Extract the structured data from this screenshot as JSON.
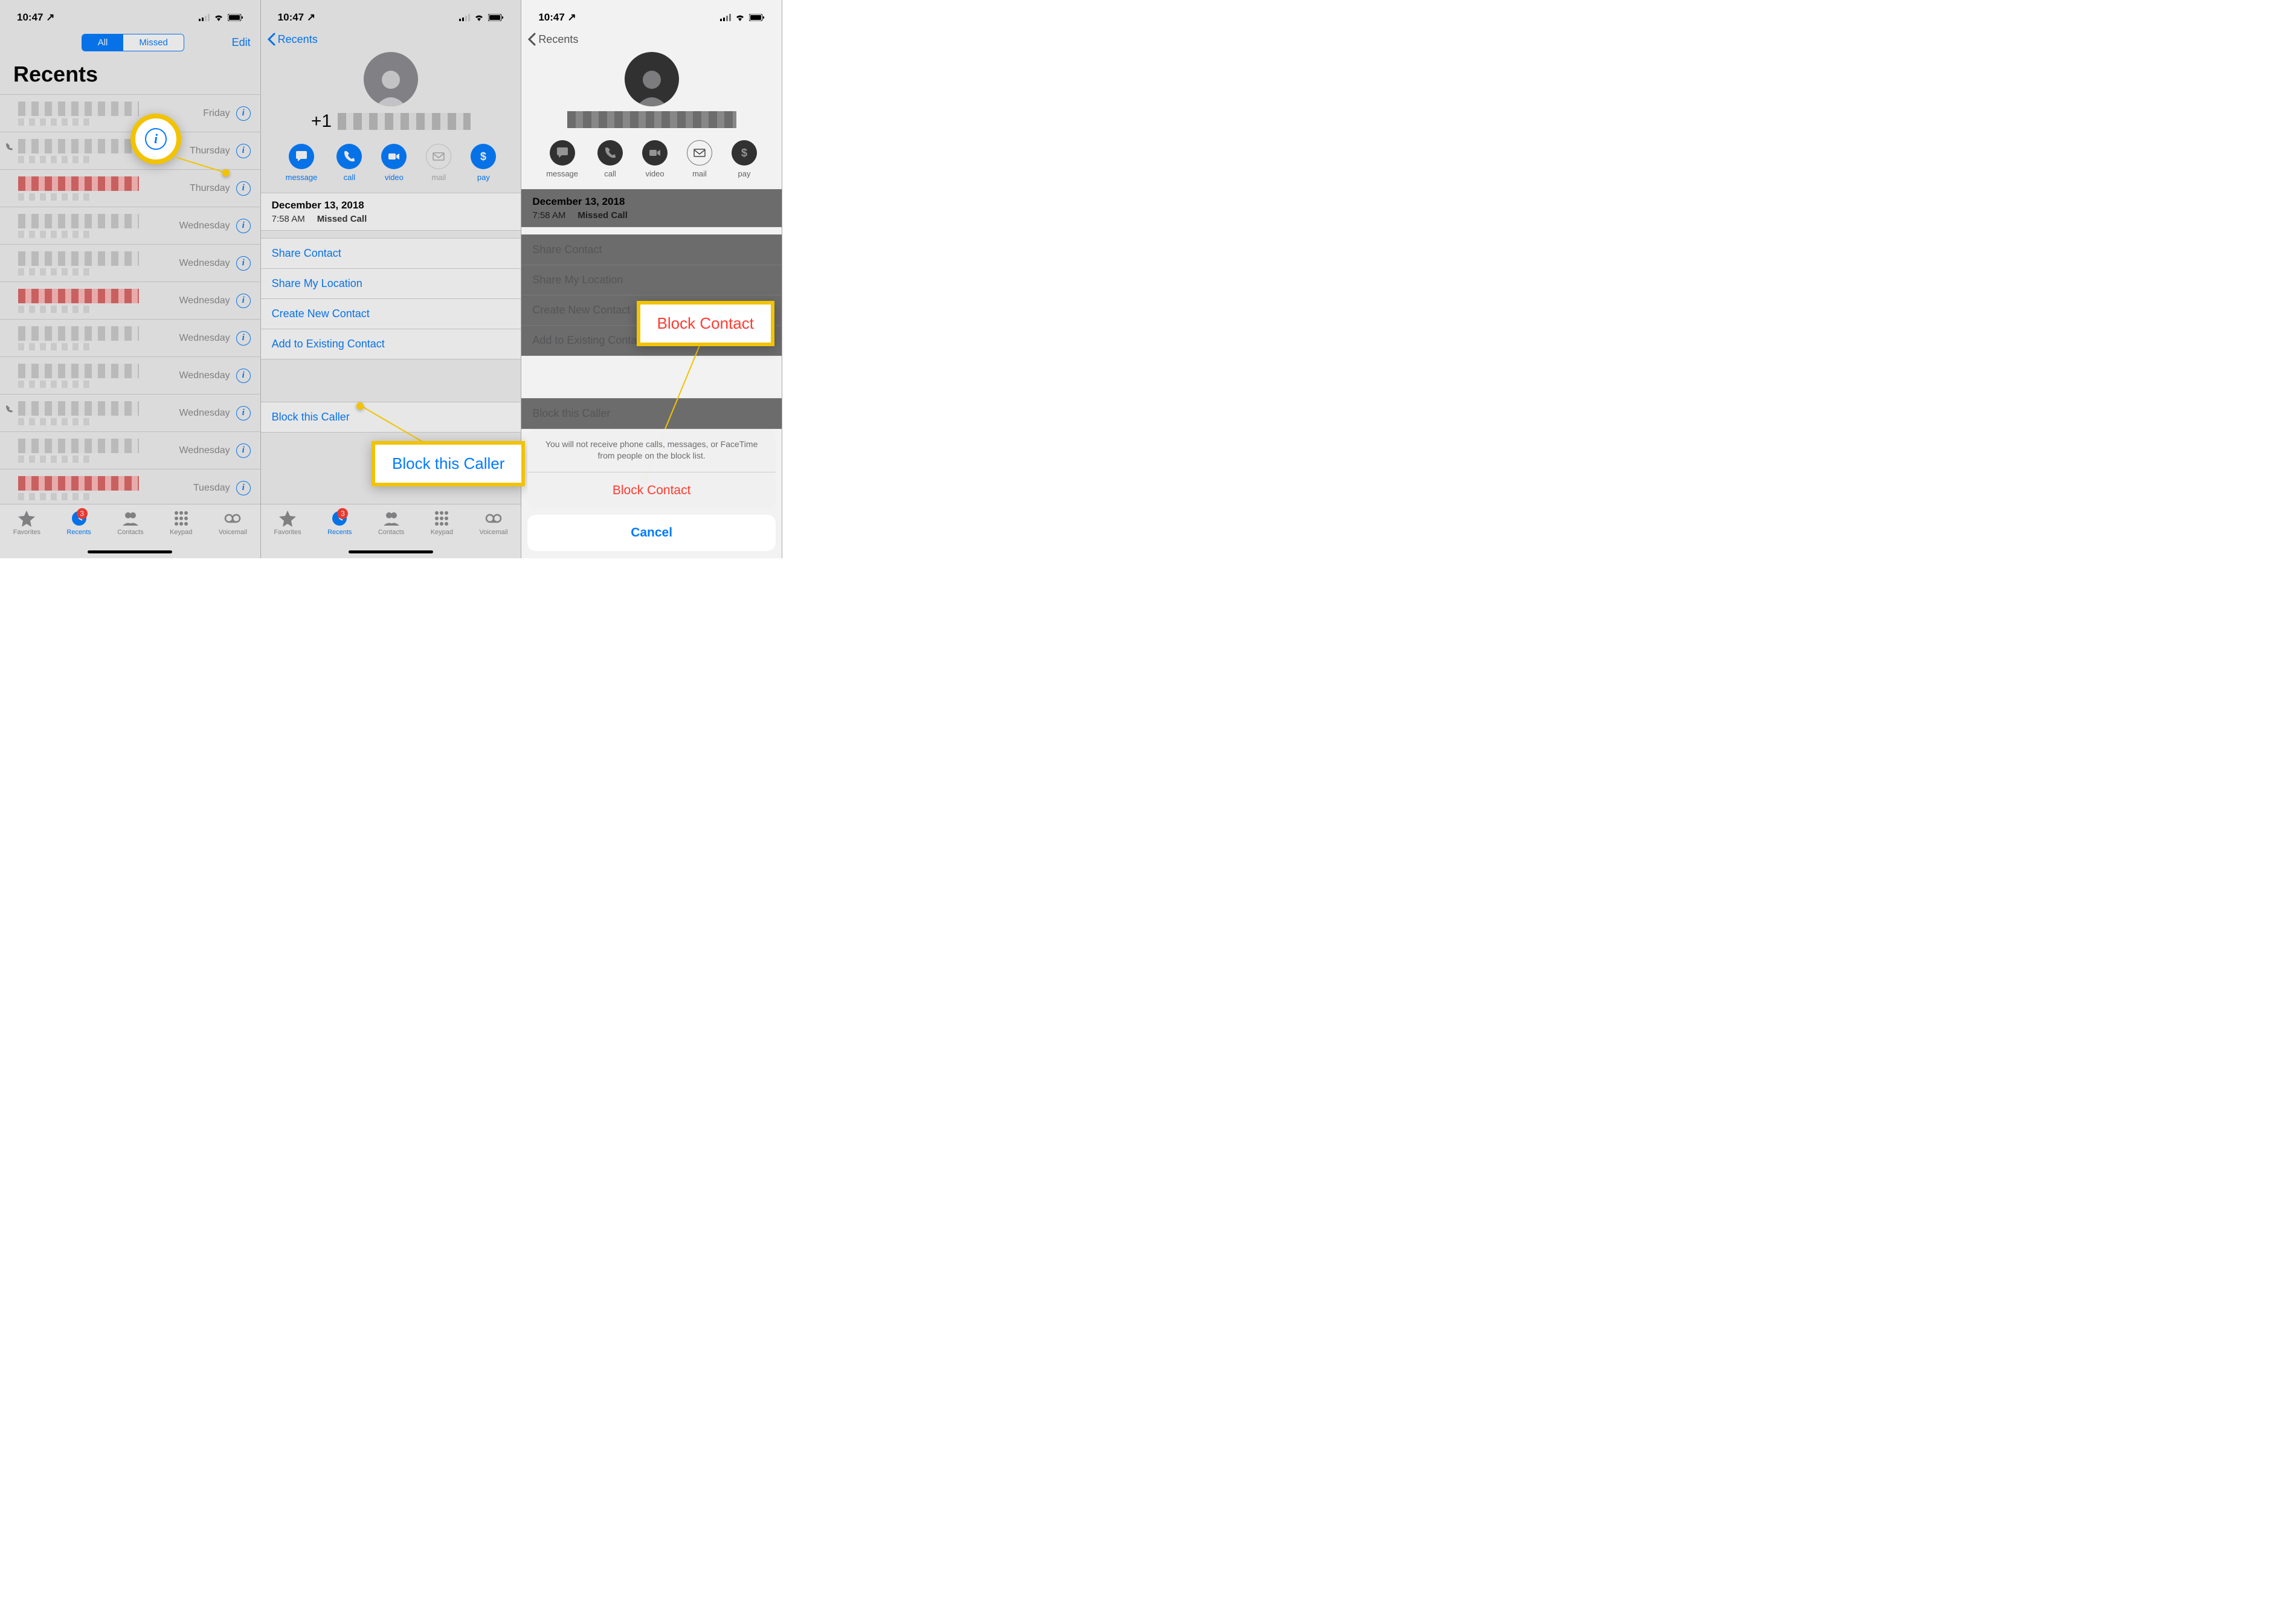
{
  "status": {
    "time": "10:47",
    "locationArrow": "↗"
  },
  "screen1": {
    "segmentAll": "All",
    "segmentMissed": "Missed",
    "edit": "Edit",
    "title": "Recents",
    "rows": [
      {
        "day": "Friday",
        "missed": false,
        "outgoing": false
      },
      {
        "day": "Thursday",
        "missed": false,
        "outgoing": true
      },
      {
        "day": "Thursday",
        "missed": true,
        "outgoing": false
      },
      {
        "day": "Wednesday",
        "missed": false,
        "outgoing": false
      },
      {
        "day": "Wednesday",
        "missed": false,
        "outgoing": false
      },
      {
        "day": "Wednesday",
        "missed": true,
        "outgoing": false
      },
      {
        "day": "Wednesday",
        "missed": false,
        "outgoing": false
      },
      {
        "day": "Wednesday",
        "missed": false,
        "outgoing": false
      },
      {
        "day": "Wednesday",
        "missed": false,
        "outgoing": true
      },
      {
        "day": "Wednesday",
        "missed": false,
        "outgoing": false
      },
      {
        "day": "Tuesday",
        "missed": true,
        "outgoing": false
      }
    ]
  },
  "detail": {
    "back": "Recents",
    "numberPrefix": "+1",
    "actions": {
      "message": "message",
      "call": "call",
      "video": "video",
      "mail": "mail",
      "pay": "pay"
    },
    "callDate": "December 13, 2018",
    "callTime": "7:58 AM",
    "callType": "Missed Call",
    "links": {
      "share": "Share Contact",
      "location": "Share My Location",
      "createNew": "Create New Contact",
      "addExisting": "Add to Existing Contact"
    },
    "block": "Block this Caller"
  },
  "sheet": {
    "message": "You will not receive phone calls, messages, or FaceTime from people on the block list.",
    "blockContact": "Block Contact",
    "cancel": "Cancel"
  },
  "tabs": {
    "favorites": "Favorites",
    "recents": "Recents",
    "contacts": "Contacts",
    "keypad": "Keypad",
    "voicemail": "Voicemail",
    "badge": "3"
  },
  "callouts": {
    "blockThisCaller": "Block this Caller",
    "blockContact": "Block Contact"
  }
}
